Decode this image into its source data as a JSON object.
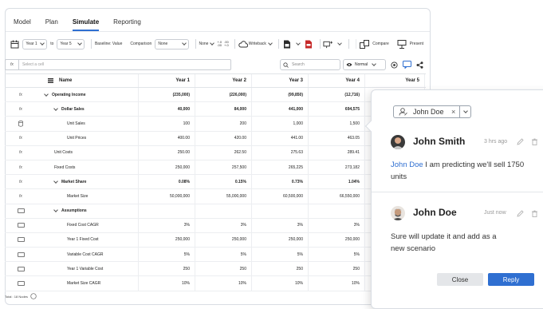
{
  "tabs": [
    "Model",
    "Plan",
    "Simulate",
    "Reporting"
  ],
  "active_tab": "Simulate",
  "toolbar": {
    "start_year": "Year 1",
    "to_label": "to",
    "end_year": "Year 5",
    "baseline_label": "Baseline: Value",
    "comparison_label": "Comparison",
    "comparison_value": "None",
    "number_format": "None",
    "dec_increase_a": "+.0",
    "dec_increase_b": ".00",
    "dec_decrease_a": ".00",
    "dec_decrease_b": "+.0",
    "writeback_label": "Writeback",
    "compare_label": "Compare",
    "present_label": "Present"
  },
  "formula_bar": {
    "fx": "fx",
    "cell_placeholder": "Select a cell",
    "search_placeholder": "Search",
    "view_mode": "Normal"
  },
  "grid": {
    "headers": [
      "Name",
      "Year 1",
      "Year 2",
      "Year 3",
      "Year 4",
      "Year 5"
    ],
    "rows": [
      {
        "type": "fx",
        "name": "Operating Income",
        "level": 0,
        "chevron": true,
        "bold": true,
        "values": [
          "(235,000)",
          "(226,000)",
          "(99,850)",
          "(12,716)",
          ""
        ]
      },
      {
        "type": "fx",
        "name": "Dollar Sales",
        "level": 1,
        "chevron": true,
        "bold": true,
        "values": [
          "40,000",
          "84,000",
          "441,000",
          "694,575",
          ""
        ]
      },
      {
        "type": "db",
        "name": "Unit Sales",
        "level": 2,
        "chevron": false,
        "bold": false,
        "values": [
          "100",
          "200",
          "1,000",
          "1,500",
          ""
        ]
      },
      {
        "type": "fx",
        "name": "Unit Prices",
        "level": 2,
        "chevron": false,
        "bold": false,
        "values": [
          "400.00",
          "420.00",
          "441.00",
          "463.05",
          ""
        ]
      },
      {
        "type": "fx",
        "name": "Unit Costs",
        "level": 1,
        "chevron": false,
        "bold": false,
        "values": [
          "250.00",
          "262.50",
          "275.63",
          "289.41",
          ""
        ]
      },
      {
        "type": "fx",
        "name": "Fixed Costs",
        "level": 1,
        "chevron": false,
        "bold": false,
        "values": [
          "250,000",
          "257,500",
          "265,225",
          "273,182",
          ""
        ]
      },
      {
        "type": "fx",
        "name": "Market Share",
        "level": 1,
        "chevron": true,
        "bold": true,
        "values": [
          "0.08%",
          "0.15%",
          "0.73%",
          "1.04%",
          ""
        ]
      },
      {
        "type": "fx",
        "name": "Market Size",
        "level": 2,
        "chevron": false,
        "bold": false,
        "values": [
          "50,000,000",
          "55,000,000",
          "60,500,000",
          "66,550,000",
          ""
        ]
      },
      {
        "type": "box",
        "name": "Assumptions",
        "level": 1,
        "chevron": true,
        "bold": true,
        "values": [
          "",
          "",
          "",
          "",
          ""
        ]
      },
      {
        "type": "box",
        "name": "Fixed Cost CAGR",
        "level": 2,
        "chevron": false,
        "bold": false,
        "values": [
          "3%",
          "3%",
          "3%",
          "3%",
          ""
        ]
      },
      {
        "type": "box",
        "name": "Year 1 Fixed Cost",
        "level": 2,
        "chevron": false,
        "bold": false,
        "values": [
          "250,000",
          "250,000",
          "250,000",
          "250,000",
          ""
        ]
      },
      {
        "type": "box",
        "name": "Variable Cost CAGR",
        "level": 2,
        "chevron": false,
        "bold": false,
        "values": [
          "5%",
          "5%",
          "5%",
          "5%",
          ""
        ]
      },
      {
        "type": "box",
        "name": "Year 1 Variable Cost",
        "level": 2,
        "chevron": false,
        "bold": false,
        "values": [
          "250",
          "250",
          "250",
          "250",
          ""
        ]
      },
      {
        "type": "box",
        "name": "Market Size CAGR",
        "level": 2,
        "chevron": false,
        "bold": false,
        "values": [
          "10%",
          "10%",
          "10%",
          "10%",
          ""
        ]
      }
    ]
  },
  "footer": {
    "total_nodes": "Total : 18 Nodes"
  },
  "comments_panel": {
    "assignee": "John Doe",
    "remove_glyph": "×",
    "comments": [
      {
        "author": "John Smith",
        "time": "3 hrs ago",
        "mention": "John Doe",
        "text": " I am predicting we'll sell 1750 units"
      },
      {
        "author": "John Doe",
        "time": "Just now",
        "mention": "",
        "text": "Sure will update it and add as a new scenario"
      }
    ],
    "close_label": "Close",
    "reply_label": "Reply"
  },
  "colors": {
    "accent": "#2f6fd1",
    "mention": "#2f6fd1",
    "border": "#d9dde3"
  }
}
